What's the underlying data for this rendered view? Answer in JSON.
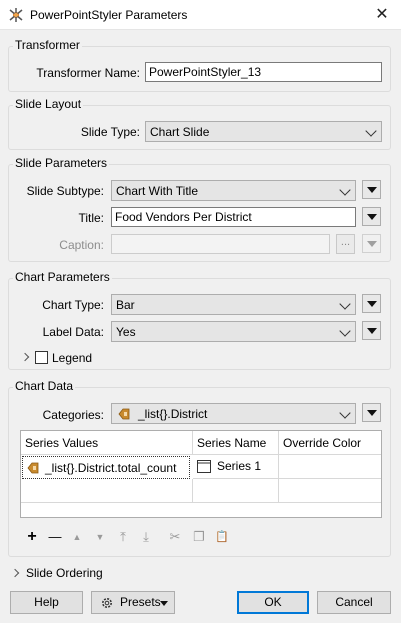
{
  "window": {
    "title": "PowerPointStyler Parameters",
    "close_glyph": "✕"
  },
  "transformer": {
    "group_title": "Transformer",
    "name_label": "Transformer Name:",
    "name_value": "PowerPointStyler_13"
  },
  "slide_layout": {
    "group_title": "Slide Layout",
    "type_label": "Slide Type:",
    "type_value": "Chart Slide"
  },
  "slide_parameters": {
    "group_title": "Slide Parameters",
    "subtype_label": "Slide Subtype:",
    "subtype_value": "Chart With Title",
    "title_label": "Title:",
    "title_value": "Food Vendors Per District",
    "caption_label": "Caption:",
    "caption_value": "",
    "ellipsis": "..."
  },
  "chart_parameters": {
    "group_title": "Chart Parameters",
    "chart_type_label": "Chart Type:",
    "chart_type_value": "Bar",
    "label_data_label": "Label Data:",
    "label_data_value": "Yes",
    "legend_label": "Legend"
  },
  "chart_data": {
    "group_title": "Chart Data",
    "categories_label": "Categories:",
    "categories_value": "_list{}.District",
    "columns": [
      "Series Values",
      "Series Name",
      "Override Color"
    ],
    "rows": [
      {
        "series_values": "_list{}.District.total_count",
        "series_name": "Series 1",
        "override_color": ""
      }
    ]
  },
  "toolbar": {
    "add": "+",
    "remove": "—",
    "move_up": "▲",
    "move_down": "▼",
    "move_top": "⤒",
    "move_bottom": "⤓",
    "cut": "✂",
    "copy": "❐",
    "paste": "📋"
  },
  "slide_ordering": {
    "label": "Slide Ordering"
  },
  "buttons": {
    "help": "Help",
    "presets": "Presets",
    "ok": "OK",
    "cancel": "Cancel"
  },
  "colors": {
    "accent": "#0078d7",
    "attribute_icon": "#c88a2e"
  }
}
